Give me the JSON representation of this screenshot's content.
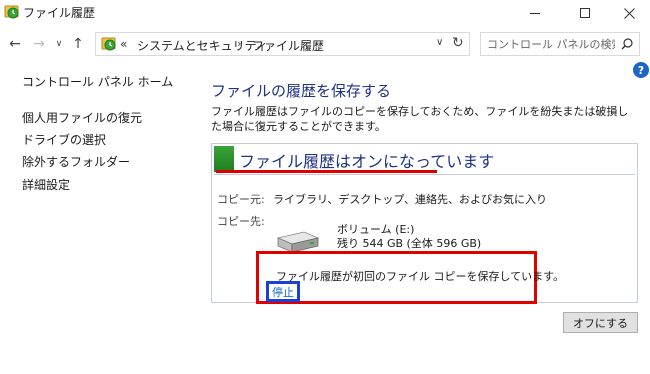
{
  "window": {
    "title": "ファイル履歴"
  },
  "nav": {
    "breadcrumb_prefix": "«",
    "breadcrumbs": [
      "システムとセキュリティ",
      "ファイル履歴"
    ],
    "separator": "›",
    "search_placeholder": "コントロール パネルの検索"
  },
  "sidebar": {
    "home": "コントロール パネル ホーム",
    "items": [
      {
        "label": "個人用ファイルの復元"
      },
      {
        "label": "ドライブの選択"
      },
      {
        "label": "除外するフォルダー"
      },
      {
        "label": "詳細設定"
      }
    ]
  },
  "main": {
    "heading": "ファイルの履歴を保存する",
    "description": "ファイル履歴はファイルのコピーを保存しておくため、ファイルを紛失または破損した場合に復元することができます。"
  },
  "status": {
    "title": "ファイル履歴はオンになっています",
    "copy_from_label": "コピー元:",
    "copy_from_value": "ライブラリ、デスクトップ、連絡先、およびお気に入り",
    "copy_to_label": "コピー先:",
    "drive_name": "ボリューム (E:)",
    "drive_space": "残り 544 GB (全体 596 GB)",
    "progress_message": "ファイル履歴が初回のファイル コピーを保存しています。",
    "stop_label": "停止"
  },
  "actions": {
    "turn_off_label": "オフにする"
  },
  "icons": {
    "help": "?",
    "back": "←",
    "forward": "→",
    "up": "↑",
    "refresh": "↻",
    "dropdown": "∨",
    "recent": "∨"
  },
  "colors": {
    "heading": "#1e3287",
    "status_on": "#2a922a",
    "highlight_red": "#e00000",
    "highlight_blue": "#1a40d6",
    "link": "#1b6ac9"
  }
}
